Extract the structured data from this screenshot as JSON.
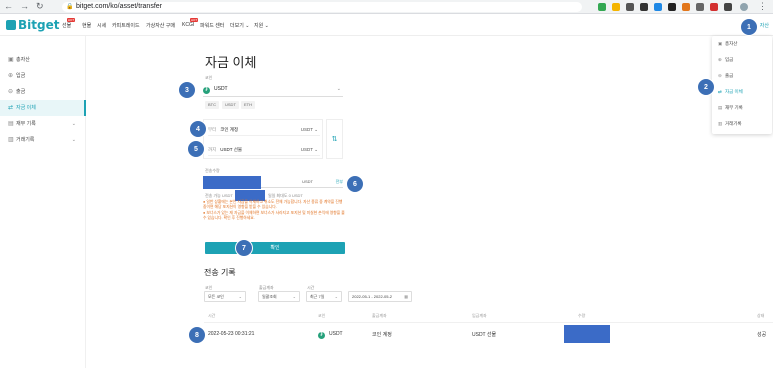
{
  "browser": {
    "url": "bitget.com/ko/asset/transfer"
  },
  "nav": {
    "logo": "Bitget",
    "items": [
      "선물",
      "현물",
      "시세",
      "카피트레이드",
      "가상자산 구매",
      "KCGI",
      "파워드 센터",
      "더보기 ⌄",
      "지원 ⌄"
    ],
    "hot": "HOT",
    "assets": "자산"
  },
  "sidebar": {
    "items": [
      {
        "label": "총자산",
        "icon": "wallet-icon"
      },
      {
        "label": "입금",
        "icon": "deposit-icon"
      },
      {
        "label": "출금",
        "icon": "withdraw-icon"
      },
      {
        "label": "자금 이체",
        "icon": "transfer-icon"
      },
      {
        "label": "재무 기록",
        "icon": "record-icon"
      },
      {
        "label": "거래기록",
        "icon": "history-icon"
      }
    ]
  },
  "dropdown": {
    "items": [
      "총자산",
      "입금",
      "출금",
      "자금 이체",
      "재무 기록",
      "거래기록"
    ]
  },
  "main": {
    "title": "자금 이체",
    "coin_label": "코인",
    "coin": "USDT",
    "chips": [
      "BTC",
      "USDT",
      "ETH"
    ],
    "from_label": "부터",
    "from_account": "코인 계정",
    "to_label": "까지",
    "to_account": "USDT 선물",
    "account_currency": "USDT",
    "amount_label": "전송수량",
    "amount_unit": "USDT",
    "all_btn": "전부",
    "available_label": "전송 가능 USDT",
    "max_label": "일일 최대도 0 USDT",
    "warnings": [
      "일반 상황에는 본인 자금을 이체하고 취소도 전체 가능합니다. 자산 종류 중 계약을 진행 중이면 해당 포지션이 영향을 받을 수 있습니다.",
      "보너스가 있는 재 자금을 이체하면 보너스가 사라지고 포지션 및 미실현 손익에 영향을 줄 수 있습니다. 확인 후 진행하세요."
    ],
    "confirm": "확인"
  },
  "history": {
    "title": "전송 기록",
    "filters": [
      {
        "label": "코인",
        "value": "모든 코인"
      },
      {
        "label": "출금계좌",
        "value": "일괄조회"
      },
      {
        "label": "시간",
        "value": "최근 7일"
      },
      {
        "label": "",
        "value": "2022-05-1 - 2022-05-2"
      }
    ],
    "columns": [
      "시간",
      "코인",
      "출금계좌",
      "입금계좌",
      "수량",
      "상태"
    ],
    "rows": [
      {
        "time": "2022-05-23 00:31:21",
        "coin": "USDT",
        "from": "코인 계정",
        "to": "USDT 선물",
        "status": "성공"
      }
    ]
  },
  "badges": [
    "1",
    "2",
    "3",
    "4",
    "5",
    "6",
    "7",
    "8"
  ],
  "colors": {
    "accent": "#1da2b4",
    "badge": "#3c6fb6",
    "redact": "#3b6bc7",
    "warn": "#e07020"
  }
}
